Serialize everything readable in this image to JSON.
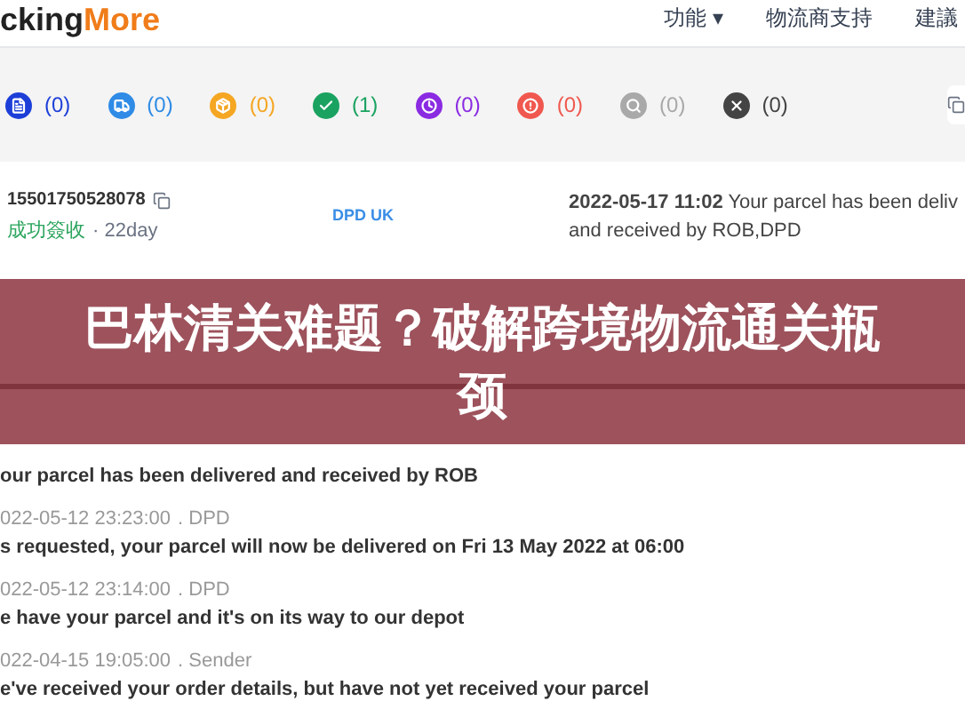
{
  "header": {
    "logo_dark": "cking",
    "logo_accent": "More",
    "nav": [
      "功能 ▾",
      "物流商支持",
      "建議"
    ]
  },
  "status_filters": [
    {
      "kind": "document",
      "count": "(0)",
      "color": "#1d3fd8"
    },
    {
      "kind": "truck",
      "count": "(0)",
      "color": "#2f8be6"
    },
    {
      "kind": "package",
      "count": "(0)",
      "color": "#f5a623"
    },
    {
      "kind": "check",
      "count": "(1)",
      "color": "#1aa260"
    },
    {
      "kind": "clock",
      "count": "(0)",
      "color": "#8a2be2"
    },
    {
      "kind": "alert",
      "count": "(0)",
      "color": "#f0584f"
    },
    {
      "kind": "search",
      "count": "(0)",
      "color": "#a9a9a9"
    },
    {
      "kind": "close",
      "count": "(0)",
      "color": "#444444"
    }
  ],
  "shipment": {
    "number": "15501750528078",
    "status": "成功簽收",
    "age": "· 22day",
    "carrier": "DPD UK",
    "latest": "**2022-05-17 11:02** Your parcel has been deliv",
    "latest_line2": "and received by ROB,DPD"
  },
  "events": [
    {
      "text": "our parcel has been delivered and received by ROB"
    },
    {
      "time": "022-05-12 23:23:00",
      "source": ". DPD",
      "text": "s requested, your parcel will now be delivered on Fri 13 May 2022 at 06:00"
    },
    {
      "time": "022-05-12 23:14:00",
      "source": ". DPD",
      "text": "e have your parcel and it's on its way to our depot"
    },
    {
      "time": "022-04-15 19:05:00",
      "source": ". Sender",
      "text": "e've received your order details, but have not yet received your parcel"
    }
  ],
  "banner": {
    "title": "巴林清关难题？破解跨境物流通关瓶颈"
  }
}
